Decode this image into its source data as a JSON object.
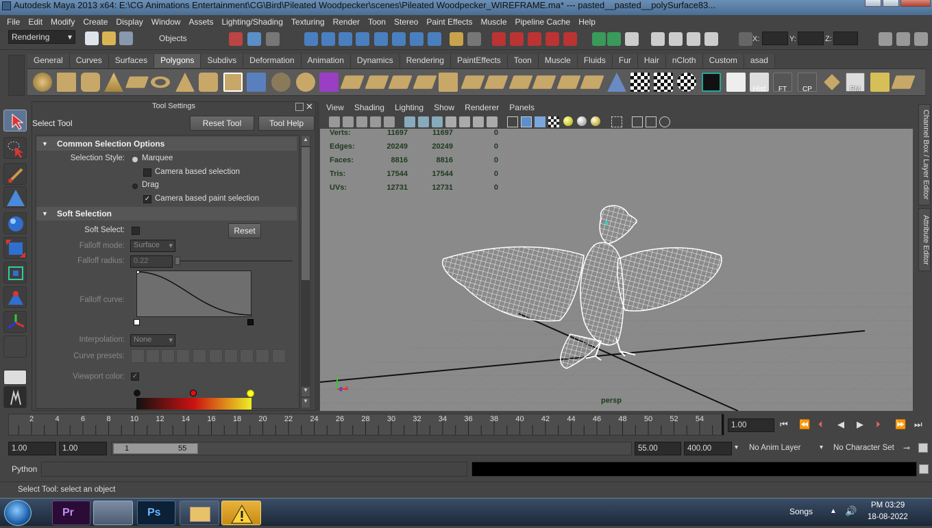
{
  "window": {
    "title": "Autodesk Maya 2013 x64: E:\\CG Animations Entertainment\\CG\\Bird\\Pileated Woodpecker\\scenes\\Pileated Woodpecker_WIREFRAME.ma* --- pasted__pasted__polySurface83..."
  },
  "menus": [
    "File",
    "Edit",
    "Modify",
    "Create",
    "Display",
    "Window",
    "Assets",
    "Lighting/Shading",
    "Texturing",
    "Render",
    "Toon",
    "Stereo",
    "Paint Effects",
    "Muscle",
    "Pipeline Cache",
    "Help"
  ],
  "status": {
    "menuset": "Rendering",
    "selmode": "Objects",
    "x_label": "X:",
    "y_label": "Y:",
    "z_label": "Z:"
  },
  "shelf_tabs": [
    "General",
    "Curves",
    "Surfaces",
    "Polygons",
    "Subdivs",
    "Deformation",
    "Animation",
    "Dynamics",
    "Rendering",
    "PaintEffects",
    "Toon",
    "Muscle",
    "Fluids",
    "Fur",
    "Hair",
    "nCloth",
    "Custom",
    "asad"
  ],
  "shelf_labels": {
    "hist": "Hist",
    "ft": "FT",
    "cp": "CP",
    "pm": "PM"
  },
  "tool_settings": {
    "header": "Tool Settings",
    "tool_name": "Select Tool",
    "reset_tool": "Reset Tool",
    "tool_help": "Tool Help",
    "common_header": "Common Selection Options",
    "selection_style_label": "Selection Style:",
    "marquee": "Marquee",
    "camera_based_selection": "Camera based selection",
    "drag": "Drag",
    "camera_based_paint": "Camera based paint selection",
    "soft_header": "Soft Selection",
    "soft_select_label": "Soft Select:",
    "reset": "Reset",
    "falloff_mode_label": "Falloff mode:",
    "falloff_mode_value": "Surface",
    "falloff_radius_label": "Falloff radius:",
    "falloff_radius_value": "0.22",
    "falloff_curve_label": "Falloff curve:",
    "interpolation_label": "Interpolation:",
    "interpolation_value": "None",
    "curve_presets_label": "Curve presets:",
    "viewport_color_label": "Viewport color:"
  },
  "viewport": {
    "menus": [
      "View",
      "Shading",
      "Lighting",
      "Show",
      "Renderer",
      "Panels"
    ],
    "hud": [
      {
        "label": "Verts:",
        "a": "11697",
        "b": "11697",
        "c": "0"
      },
      {
        "label": "Edges:",
        "a": "20249",
        "b": "20249",
        "c": "0"
      },
      {
        "label": "Faces:",
        "a": "8816",
        "b": "8816",
        "c": "0"
      },
      {
        "label": "Tris:",
        "a": "17544",
        "b": "17544",
        "c": "0"
      },
      {
        "label": "UVs:",
        "a": "12731",
        "b": "12731",
        "c": "0"
      }
    ],
    "camera": "persp",
    "axis_z": "z",
    "axis_x": "x"
  },
  "right_tabs": {
    "channel": "Channel Box / Layer Editor",
    "attr": "Attribute Editor"
  },
  "time": {
    "ticks": [
      "2",
      "4",
      "6",
      "8",
      "10",
      "12",
      "14",
      "16",
      "18",
      "20",
      "22",
      "24",
      "26",
      "28",
      "30",
      "32",
      "34",
      "36",
      "38",
      "40",
      "42",
      "44",
      "46",
      "48",
      "50",
      "52",
      "54"
    ],
    "current": "1.00"
  },
  "range": {
    "start": "1.00",
    "inner_start": "1.00",
    "slider_start": "1",
    "slider_end": "55",
    "inner_end": "55.00",
    "end": "400.00",
    "anim_layer": "No Anim Layer",
    "char_set": "No Character Set"
  },
  "cmd": {
    "lang": "Python"
  },
  "help": {
    "text": "Select Tool: select an object"
  },
  "taskbar": {
    "songs": "Songs",
    "time": "PM 03:29",
    "date": "18-08-2022"
  }
}
